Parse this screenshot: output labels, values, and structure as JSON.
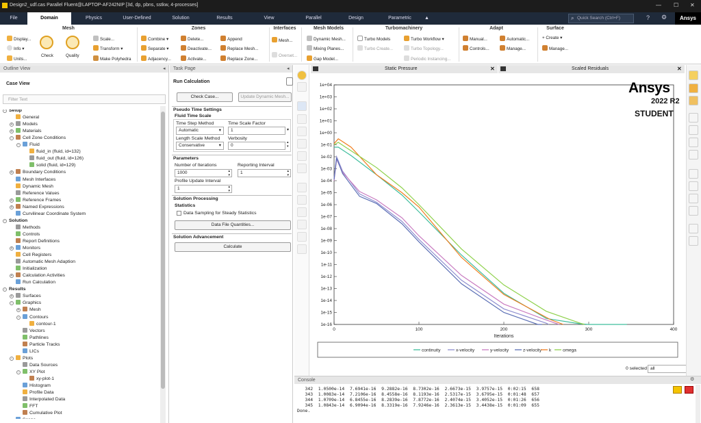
{
  "window": {
    "title": "Design2_udf.cas Parallel Fluent@LAPTOP-AF242NIP  [3d, dp, pbns, sstkw, 4-processes]",
    "search_placeholder": "Quick Search (Ctrl+F)",
    "brand": "Ansys"
  },
  "menu": [
    "File",
    "Domain",
    "Physics",
    "User-Defined",
    "Solution",
    "Results",
    "View",
    "Parallel",
    "Design",
    "Parametric"
  ],
  "ribbon": {
    "mesh": {
      "title": "Mesh",
      "display": "Display...",
      "info": "Info",
      "units": "Units...",
      "check": "Check",
      "quality": "Quality",
      "scale": "Scale...",
      "transform": "Transform",
      "polyhedra": "Make Polyhedra"
    },
    "zones": {
      "title": "Zones",
      "combine": "Combine",
      "separate": "Separate",
      "adjacency": "Adjacency...",
      "delete": "Delete...",
      "deactivate": "Deactivate...",
      "activate": "Activate...",
      "append": "Append",
      "replace_mesh": "Replace Mesh...",
      "replace_zone": "Replace Zone..."
    },
    "interfaces": {
      "title": "Interfaces",
      "mesh": "Mesh...",
      "overset": "Overset..."
    },
    "mesh_models": {
      "title": "Mesh Models",
      "dynamic": "Dynamic Mesh...",
      "mixing": "Mixing Planes...",
      "gap": "Gap Model..."
    },
    "turbo": {
      "title": "Turbomachinery",
      "models": "Turbo Models",
      "create": "Turbo Create...",
      "workflow": "Turbo Workflow",
      "topology": "Turbo Topology...",
      "periodic": "Periodic Instancing..."
    },
    "adapt": {
      "title": "Adapt",
      "manual": "Manual...",
      "automatic": "Automatic...",
      "controls": "Controls...",
      "manage": "Manage..."
    },
    "surface": {
      "title": "Surface",
      "create": "+ Create",
      "manage": "Manage..."
    }
  },
  "outline": {
    "title": "Outline View",
    "case_view": "Case View",
    "filter_placeholder": "Filter Text",
    "items": [
      {
        "l": 0,
        "e": "-",
        "t": "Setup",
        "b": 1
      },
      {
        "l": 1,
        "t": "General"
      },
      {
        "l": 1,
        "e": "+",
        "t": "Models"
      },
      {
        "l": 1,
        "e": "+",
        "t": "Materials"
      },
      {
        "l": 1,
        "e": "-",
        "t": "Cell Zone Conditions"
      },
      {
        "l": 2,
        "e": "-",
        "t": "Fluid"
      },
      {
        "l": 3,
        "t": "fluid_in (fluid, id=132)"
      },
      {
        "l": 3,
        "t": "fluid_out (fluid, id=126)"
      },
      {
        "l": 3,
        "t": "solid (fluid, id=129)"
      },
      {
        "l": 1,
        "e": "+",
        "t": "Boundary Conditions"
      },
      {
        "l": 1,
        "t": "Mesh Interfaces"
      },
      {
        "l": 1,
        "t": "Dynamic Mesh"
      },
      {
        "l": 1,
        "t": "Reference Values"
      },
      {
        "l": 1,
        "e": "+",
        "t": "Reference Frames"
      },
      {
        "l": 1,
        "e": "+",
        "t": "Named Expressions"
      },
      {
        "l": 1,
        "t": "Curvilinear Coordinate System"
      },
      {
        "l": 0,
        "e": "-",
        "t": "Solution",
        "b": 1
      },
      {
        "l": 1,
        "t": "Methods"
      },
      {
        "l": 1,
        "t": "Controls"
      },
      {
        "l": 1,
        "t": "Report Definitions"
      },
      {
        "l": 1,
        "e": "+",
        "t": "Monitors"
      },
      {
        "l": 1,
        "t": "Cell Registers"
      },
      {
        "l": 1,
        "t": "Automatic Mesh Adaption"
      },
      {
        "l": 1,
        "t": "Initialization"
      },
      {
        "l": 1,
        "e": "+",
        "t": "Calculation Activities"
      },
      {
        "l": 1,
        "t": "Run Calculation"
      },
      {
        "l": 0,
        "e": "-",
        "t": "Results",
        "b": 1
      },
      {
        "l": 1,
        "e": "+",
        "t": "Surfaces"
      },
      {
        "l": 1,
        "e": "-",
        "t": "Graphics"
      },
      {
        "l": 2,
        "e": "+",
        "t": "Mesh"
      },
      {
        "l": 2,
        "e": "-",
        "t": "Contours"
      },
      {
        "l": 3,
        "t": "contour-1"
      },
      {
        "l": 2,
        "t": "Vectors"
      },
      {
        "l": 2,
        "t": "Pathlines"
      },
      {
        "l": 2,
        "t": "Particle Tracks"
      },
      {
        "l": 2,
        "t": "LICs"
      },
      {
        "l": 1,
        "e": "-",
        "t": "Plots"
      },
      {
        "l": 2,
        "t": "Data Sources"
      },
      {
        "l": 2,
        "e": "-",
        "t": "XY Plot"
      },
      {
        "l": 3,
        "t": "xy-plot-1"
      },
      {
        "l": 2,
        "t": "Histogram"
      },
      {
        "l": 2,
        "t": "Profile Data"
      },
      {
        "l": 2,
        "t": "Interpolated Data"
      },
      {
        "l": 2,
        "t": "FFT"
      },
      {
        "l": 2,
        "t": "Cumulative Plot"
      },
      {
        "l": 1,
        "t": "Scene"
      },
      {
        "l": 1,
        "e": "+",
        "t": "Animations"
      }
    ]
  },
  "task": {
    "title": "Task Page",
    "run_calc": "Run Calculation",
    "check_case": "Check Case...",
    "update_mesh": "Update Dynamic Mesh...",
    "pseudo": "Pseudo Time Settings",
    "fluid_ts": "Fluid Time Scale",
    "tsm_label": "Time Step Method",
    "tsm_value": "Automatic",
    "tsf_label": "Time Scale Factor",
    "tsf_value": "1",
    "lsm_label": "Length Scale Method",
    "lsm_value": "Conservative",
    "verb_label": "Verbosity",
    "verb_value": "0",
    "parameters": "Parameters",
    "iter_label": "Number of Iterations",
    "iter_value": "1000",
    "rep_label": "Reporting Interval",
    "rep_value": "1",
    "pui_label": "Profile Update Interval",
    "pui_value": "1",
    "sol_proc": "Solution Processing",
    "statistics": "Statistics",
    "data_sampling": "Data Sampling for Steady Statistics",
    "data_file": "Data File Quantities...",
    "sol_adv": "Solution Advancement",
    "calculate": "Calculate"
  },
  "graphics": {
    "tab1": "Static Pressure",
    "tab2": "Scaled Residuals",
    "logo": "Ansys",
    "version": "2022 R2",
    "edition": "STUDENT",
    "selected": "0 selected",
    "filter": "all"
  },
  "chart_data": {
    "type": "line",
    "xlabel": "Iterations",
    "ylabel": "",
    "xlim": [
      0,
      400
    ],
    "ylim_log10": [
      -16,
      4
    ],
    "log_y": true,
    "x_ticks": [
      0,
      100,
      200,
      300,
      400
    ],
    "y_ticks": [
      "1e-16",
      "1e-15",
      "1e-14",
      "1e-13",
      "1e-12",
      "1e-11",
      "1e-10",
      "1e-09",
      "1e-08",
      "1e-07",
      "1e-06",
      "1e-05",
      "1e-04",
      "1e-03",
      "1e-02",
      "1e-01",
      "1e+00",
      "1e+01",
      "1e+02",
      "1e+03",
      "1e+04"
    ],
    "legend_position": "bottom",
    "series": [
      {
        "name": "continuity",
        "color": "#3dbd9c",
        "x": [
          0,
          5,
          20,
          50,
          80,
          100,
          150,
          200,
          250,
          290,
          300,
          345
        ],
        "y_log10": [
          -1.2,
          -1.2,
          -1.9,
          -3.5,
          -5.2,
          -6.6,
          -10.2,
          -13.4,
          -15.5,
          -15.95,
          -16,
          -16
        ]
      },
      {
        "name": "x-velocity",
        "color": "#8f8fd0",
        "x": [
          0,
          3,
          10,
          30,
          50,
          80,
          100,
          150,
          200,
          250,
          253
        ],
        "y_log10": [
          -3.8,
          -2,
          -3.2,
          -5.1,
          -5.8,
          -7.4,
          -8.9,
          -12.3,
          -14.7,
          -15.9,
          -16
        ]
      },
      {
        "name": "y-velocity",
        "color": "#c97cc1",
        "x": [
          0,
          3,
          10,
          30,
          50,
          80,
          100,
          150,
          200,
          245,
          265
        ],
        "y_log10": [
          -4,
          -2.2,
          -3.3,
          -4.9,
          -5.6,
          -7.1,
          -8.6,
          -11.9,
          -14.3,
          -15.5,
          -16
        ]
      },
      {
        "name": "z-velocity",
        "color": "#5b6fb5",
        "x": [
          0,
          3,
          10,
          30,
          50,
          80,
          100,
          150,
          200,
          240,
          245
        ],
        "y_log10": [
          -3.9,
          -2.1,
          -3.4,
          -5.3,
          -5.9,
          -7.6,
          -9.1,
          -12.6,
          -15,
          -16,
          -16
        ]
      },
      {
        "name": "k",
        "color": "#f07d1e",
        "x": [
          0,
          5,
          20,
          50,
          80,
          100,
          150,
          200,
          255,
          270
        ],
        "y_log10": [
          -0.9,
          -0.5,
          -1.2,
          -3.5,
          -5,
          -6.2,
          -10.4,
          -13.5,
          -15.6,
          -16
        ]
      },
      {
        "name": "omega",
        "color": "#8ed14b",
        "x": [
          0,
          5,
          20,
          50,
          80,
          100,
          150,
          200,
          250,
          290,
          295
        ],
        "y_log10": [
          -1,
          -0.8,
          -1.5,
          -2.9,
          -4.6,
          -6,
          -9.7,
          -12.7,
          -14.9,
          -15.9,
          -16
        ]
      }
    ]
  },
  "console": {
    "title": "Console",
    "lines": [
      "   342  1.0500e-14  7.6941e-16  9.2882e-16  8.7302e-16  2.6673e-15  3.9757e-15  0:02:15  658",
      "   343  1.0083e-14  7.2106e-16  8.4558e-16  8.1193e-16  2.5317e-15  3.6795e-15  0:01:48  657",
      "   344  1.0709e-14  6.8455e-16  8.2839e-16  7.8772e-16  2.4074e-15  3.4052e-15  0:01:26  656",
      "   345  1.0843e-14  6.9094e-16  8.3319e-16  7.9246e-16  2.3613e-15  3.4438e-15  0:01:09  655",
      "Done."
    ]
  },
  "colors": {
    "menubar": "#1f2a3a",
    "accent": "#f5c400"
  }
}
